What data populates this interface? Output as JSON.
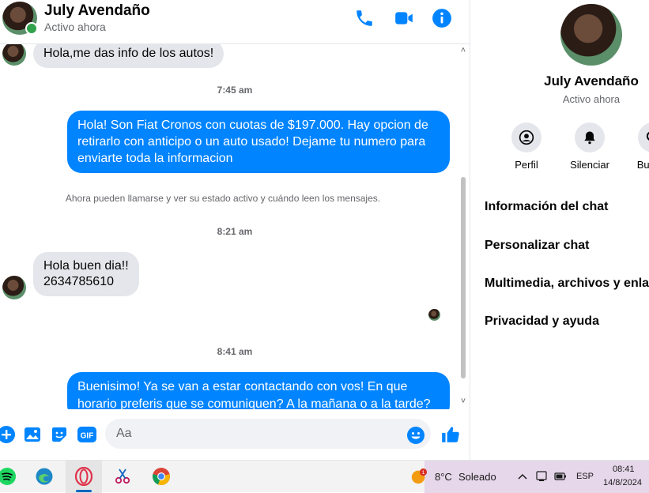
{
  "header": {
    "name": "July Avendaño",
    "status": "Activo ahora",
    "icons": [
      "phone-icon",
      "video-call-icon",
      "info-icon"
    ]
  },
  "chat": {
    "messages": [
      {
        "from": "contact",
        "text": "Hola,me das info de los autos!"
      },
      {
        "time": "7:45 am"
      },
      {
        "from": "me",
        "text": "Hola! Son Fiat Cronos con cuotas de $197.000. Hay opcion de retirarlo con anticipo o un auto usado! Dejame tu numero para enviarte toda la informacion"
      },
      {
        "system": "Ahora pueden llamarse y ver su estado activo y cuándo leen los mensajes."
      },
      {
        "time": "8:21 am"
      },
      {
        "from": "contact",
        "text_lines": [
          "Hola buen dia!!",
          "2634785610"
        ]
      },
      {
        "time": "8:41 am"
      },
      {
        "from": "me",
        "text_lines": [
          "Buenisimo! Ya se van a estar contactando con vos! En que",
          "horario preferis que se comuniquen? A la mañana o a la tarde?"
        ]
      }
    ]
  },
  "composer": {
    "placeholder": "Aa",
    "icons": [
      "plus-icon",
      "image-icon",
      "sticker-icon",
      "gif-icon",
      "emoji-icon",
      "like-icon"
    ],
    "gif_label": "GIF"
  },
  "right_panel": {
    "name": "July Avendaño",
    "status": "Activo ahora",
    "actions": [
      {
        "label": "Perfil",
        "icon": "profile-icon"
      },
      {
        "label": "Silenciar",
        "icon": "bell-icon"
      },
      {
        "label": "Buscar",
        "icon": "search-icon"
      }
    ],
    "menu": [
      "Información del chat",
      "Personalizar chat",
      "Multimedia, archivos y enlaces",
      "Privacidad y ayuda"
    ]
  },
  "taskbar": {
    "apps": [
      "spotify-icon",
      "edge-icon",
      "opera-icon",
      "snipping-tool-icon",
      "chrome-icon"
    ],
    "weather": {
      "temp": "8°C",
      "condition": "Soleado",
      "badge": "1"
    },
    "language": "ESP",
    "time": "08:41",
    "date": "14/8/2024"
  },
  "colors": {
    "accent": "#0084ff",
    "incoming_bubble": "#e4e6eb",
    "online": "#31a24c"
  }
}
